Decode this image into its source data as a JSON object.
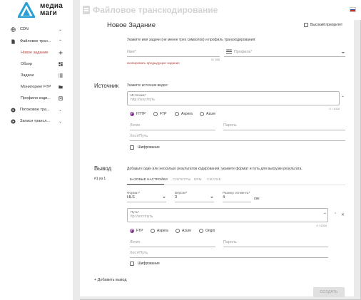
{
  "brand": {
    "line1": "медиа",
    "line2": "маги"
  },
  "header": {
    "title": "Файловое транскодирование"
  },
  "sidebar": {
    "items": [
      {
        "label": "CDN",
        "icon": "globe-icon"
      },
      {
        "label": "Файловое тран...",
        "icon": "file-icon"
      },
      {
        "label": "Потоковое тра...",
        "icon": "play-icon"
      },
      {
        "label": "Записи трансл...",
        "icon": "play-icon"
      }
    ],
    "subitems": [
      {
        "label": "Новое задание",
        "icon": "plus-icon"
      },
      {
        "label": "Обзор",
        "icon": "dashboard-icon"
      },
      {
        "label": "Задачи",
        "icon": "list-icon"
      },
      {
        "label": "Мониторинг FTP",
        "icon": "folder-icon"
      },
      {
        "label": "Профили коди...",
        "icon": "clipboard-icon"
      }
    ]
  },
  "form": {
    "title": "Новое Задание",
    "priority_label": "Высокий приоритет",
    "task_hint": "Укажите имя задачи (не менее трех символов) и профиль транскодирования:",
    "name_placeholder": "Имя*",
    "name_counter": "0 / 255",
    "profile_placeholder": "Профиль*",
    "copy_link": "скопировать предыдущее задание"
  },
  "source": {
    "section": "Источник",
    "hint": "Укажите источник видео:",
    "url_label": "Источник*",
    "url_placeholder": "http://хост/путь",
    "url_counter": "0 / 1024",
    "protocols": [
      "HTTP",
      "FTP",
      "Aspera",
      "Azure"
    ],
    "login_placeholder": "Логин",
    "password_placeholder": "Пароль",
    "hostpath_placeholder": "Хост/Путь",
    "encryption_label": "Шифрование"
  },
  "output": {
    "section": "Вывод",
    "counter": "#1 из 1",
    "hint": "Добавьте один или несколько результатов кодирования; укажите формат и путь для выгрузки результата.",
    "tabs": [
      "БАЗОВЫЕ НАСТРОЙКИ",
      "СУБТИТРЫ",
      "DRM",
      "СЖАТИЕ"
    ],
    "format_label": "Формат*",
    "format_value": "HLS",
    "version_label": "Версия*",
    "version_value": "3",
    "segment_label": "Размер сегмента*",
    "segment_value": "4",
    "segment_unit": "сек",
    "path_label": "Путь*",
    "path_placeholder": "ftp://хост/путь",
    "path_counter": "0 / 1024",
    "protocols": [
      "FTP",
      "Aspera",
      "Azure",
      "Origin"
    ],
    "login_placeholder": "Логин",
    "password_placeholder": "Пароль",
    "hostpath_placeholder": "Хост/Путь",
    "encryption_label": "Шифрование",
    "add_label": "+ Добавить вывод",
    "create_label": "СОЗДАТЬ"
  },
  "colors": {
    "accent": "#b0403c",
    "radio": "#7b2f8a",
    "logo": "#2aa1d6"
  }
}
